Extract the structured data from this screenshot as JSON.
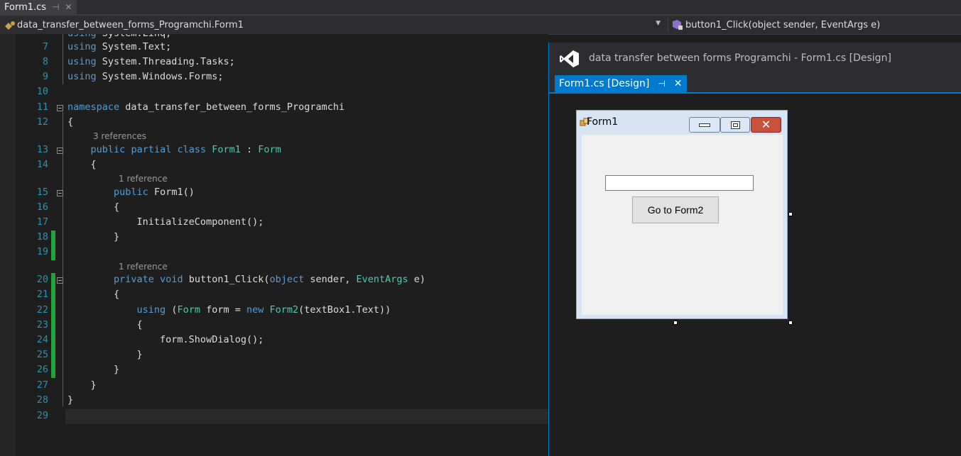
{
  "tab": {
    "title": "Form1.cs",
    "pin": "⊣",
    "close": "✕"
  },
  "nav": {
    "class_path": "data_transfer_between_forms_Programchi.Form1",
    "member": "button1_Click(object sender, EventArgs e)"
  },
  "editor": {
    "partial_top_line": "using System.Linq;",
    "line_numbers": [
      "7",
      "8",
      "9",
      "10",
      "11",
      "12",
      "13",
      "14",
      "15",
      "16",
      "17",
      "18",
      "19",
      "20",
      "21",
      "22",
      "23",
      "24",
      "25",
      "26",
      "27",
      "28",
      "29"
    ],
    "lenses": [
      "3 references",
      "1 reference",
      "1 reference"
    ],
    "colors": {
      "keyword": "#569cd6",
      "type": "#4ec9b0",
      "line_number": "#2b91af",
      "change_bar": "#24a23a"
    }
  },
  "designer": {
    "window_title": "data transfer between forms Programchi - Form1.cs [Design]",
    "tab_label": "Form1.cs [Design]",
    "form": {
      "title": "Form1",
      "button_text": "Go to Form2",
      "textbox_value": ""
    }
  }
}
